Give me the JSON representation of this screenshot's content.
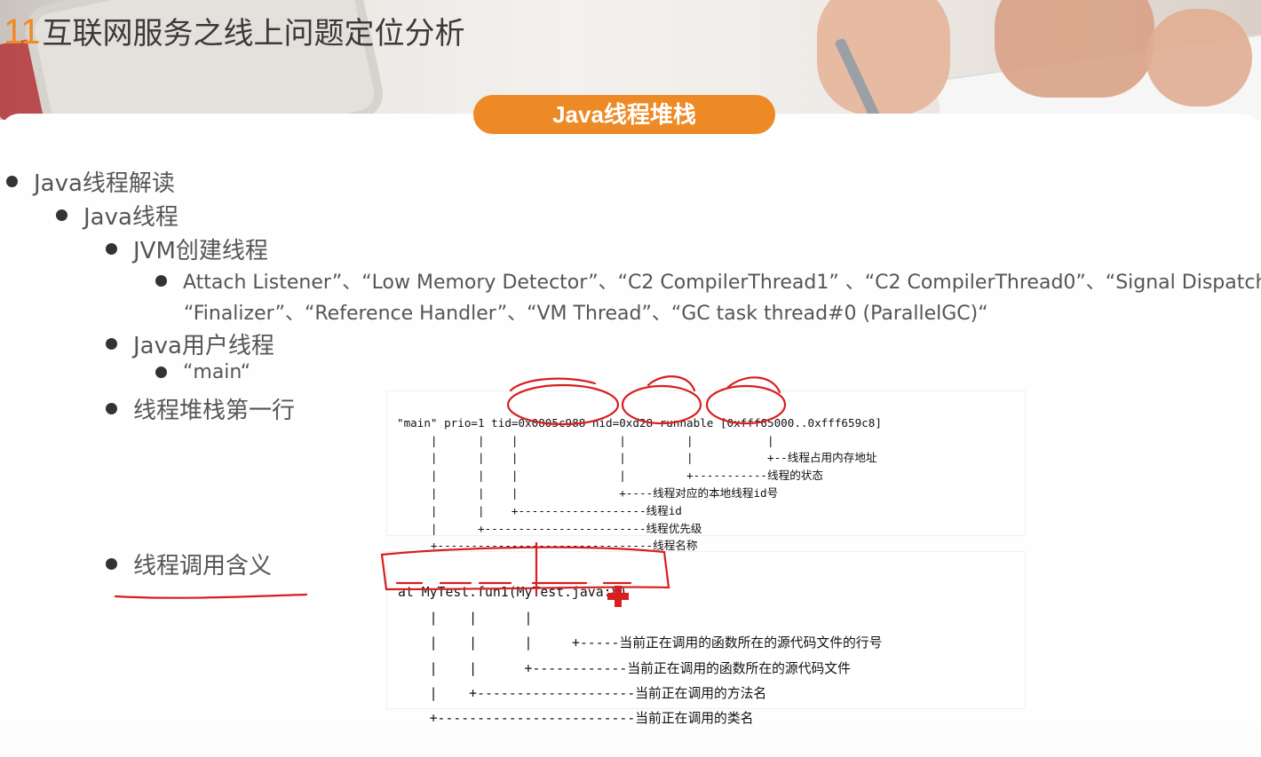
{
  "header": {
    "chapter_number": "11",
    "title": "互联网服务之线上问题定位分析",
    "section_pill": "Java线程堆栈"
  },
  "outline": [
    {
      "level": 1,
      "text": "Java线程解读"
    },
    {
      "level": 2,
      "text": "Java线程"
    },
    {
      "level": 3,
      "text": "JVM创建线程"
    },
    {
      "level": 4,
      "text": "Attach Listener”、“Low Memory Detector”、“C2 CompilerThread1” 、“C2 CompilerThread0”、“Signal Dispatcher”、",
      "continuation": "“Finalizer”、“Reference Handler”、“VM Thread”、“GC task thread#0 (ParallelGC)“"
    },
    {
      "level": 3,
      "text": "Java用户线程"
    },
    {
      "level": 4,
      "text": "“main“"
    },
    {
      "level": 3,
      "text": "线程堆栈第一行"
    },
    {
      "level": 3,
      "text": "线程调用含义"
    }
  ],
  "code_first_line": [
    "\"main\" prio=1 tid=0x0805c988 nid=0xd28 runnable [0xfff65000..0xfff659c8]",
    "     |      |    |               |         |           |",
    "     |      |    |               |         |           +--线程占用内存地址",
    "     |      |    |               |         +-----------线程的状态",
    "     |      |    |               +----线程对应的本地线程id号",
    "     |      |    +-------------------线程id",
    "     |      +------------------------线程优先级",
    "     +--------------------------------线程名称"
  ],
  "code_call": [
    "at MyTest.fun1(MyTest.java:8)",
    "    |    |      |",
    "    |    |      |     +-----当前正在调用的函数所在的源代码文件的行号",
    "    |    |      +------------当前正在调用的函数所在的源代码文件",
    "    |    +--------------------当前正在调用的方法名",
    "    +-------------------------当前正在调用的类名"
  ],
  "colors": {
    "accent": "#ee8a25",
    "annotation_red": "#d81e1e"
  }
}
